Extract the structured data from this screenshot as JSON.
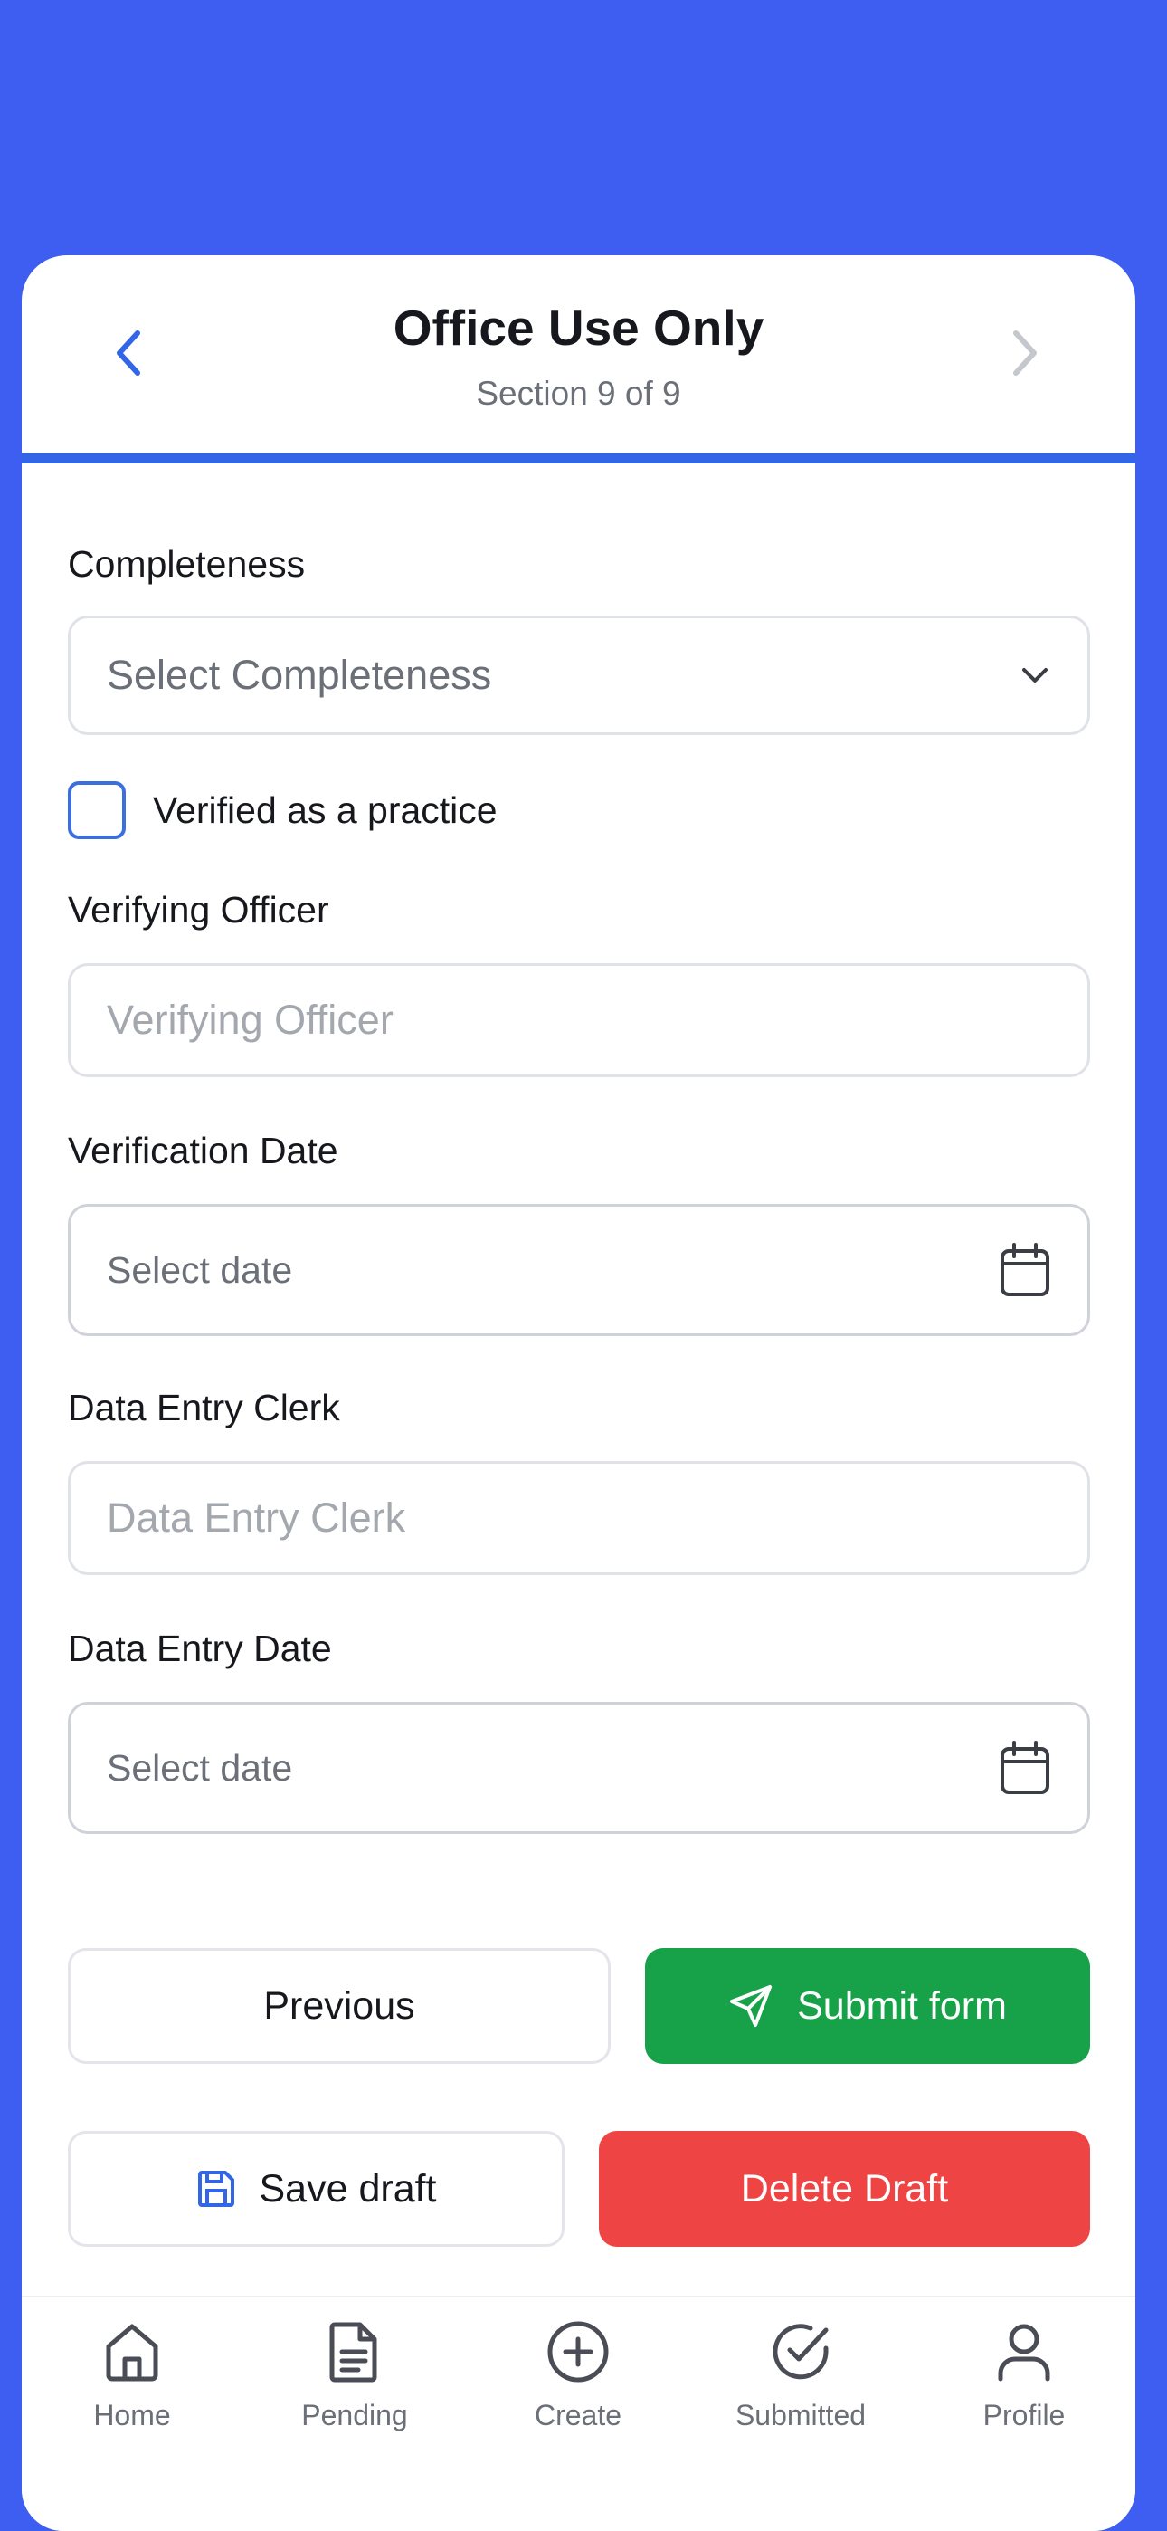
{
  "header": {
    "title": "Office Use Only",
    "subtitle": "Section 9 of 9",
    "back_icon": "chevron-left-icon",
    "forward_icon": "chevron-right-icon",
    "accent": "#3366e6"
  },
  "form": {
    "completeness": {
      "label": "Completeness",
      "placeholder": "Select Completeness",
      "icon": "chevron-down-icon"
    },
    "verified_checkbox": {
      "label": "Verified as a practice",
      "checked": false
    },
    "verifying_officer": {
      "label": "Verifying Officer",
      "placeholder": "Verifying Officer"
    },
    "verification_date": {
      "label": "Verification Date",
      "placeholder": "Select date",
      "icon": "calendar-icon"
    },
    "data_entry_clerk": {
      "label": "Data Entry Clerk",
      "placeholder": "Data Entry Clerk"
    },
    "data_entry_date": {
      "label": "Data Entry Date",
      "placeholder": "Select date",
      "icon": "calendar-icon"
    }
  },
  "actions": {
    "previous_label": "Previous",
    "submit_label": "Submit form",
    "submit_icon": "send-icon",
    "save_draft_label": "Save draft",
    "save_icon": "save-icon",
    "delete_draft_label": "Delete Draft",
    "colors": {
      "submit": "#17a24a",
      "delete": "#ee4444"
    }
  },
  "bottom_nav": {
    "items": [
      {
        "label": "Home",
        "icon": "home-icon"
      },
      {
        "label": "Pending",
        "icon": "document-icon"
      },
      {
        "label": "Create",
        "icon": "plus-circle-icon"
      },
      {
        "label": "Submitted",
        "icon": "check-circle-icon"
      },
      {
        "label": "Profile",
        "icon": "user-icon"
      }
    ]
  }
}
